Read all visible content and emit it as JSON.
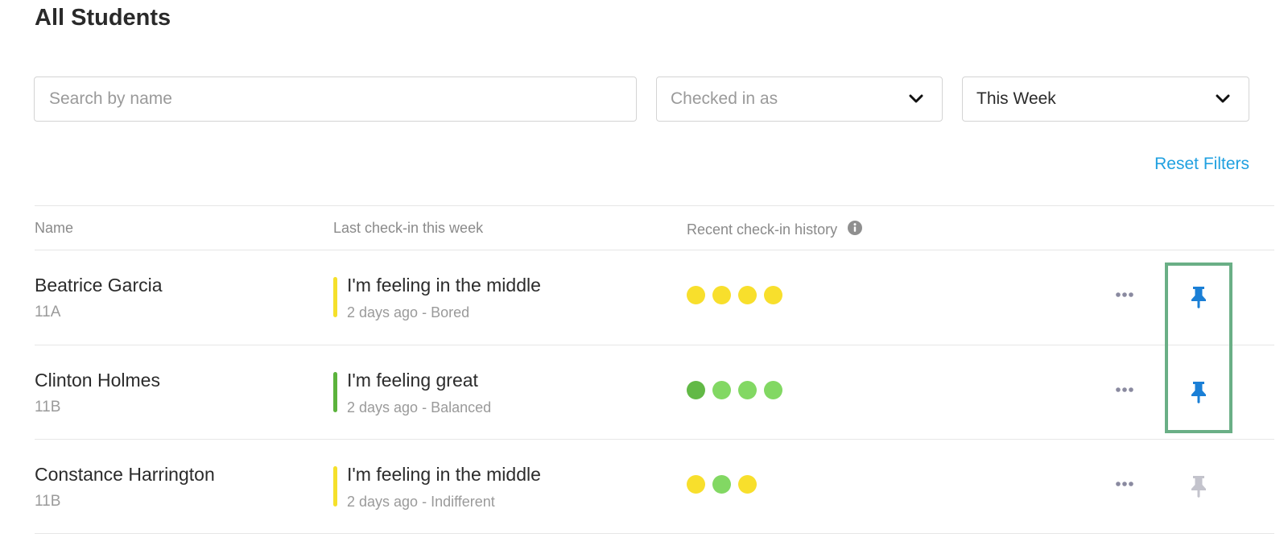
{
  "page": {
    "title": "All Students"
  },
  "filters": {
    "search_placeholder": "Search by name",
    "checked_in_placeholder": "Checked in as",
    "period_value": "This Week",
    "reset_label": "Reset Filters"
  },
  "table": {
    "headers": {
      "name": "Name",
      "last_checkin": "Last check-in this week",
      "history": "Recent check-in history"
    },
    "rows": [
      {
        "name": "Beatrice Garcia",
        "class": "11A",
        "feeling": "I'm feeling in the middle",
        "detail": "2 days ago - Bored",
        "bar_color": "#f5e02b",
        "history": [
          "#f8df2c",
          "#f8df2c",
          "#f8df2c",
          "#f8df2c"
        ],
        "pinned": true
      },
      {
        "name": "Clinton Holmes",
        "class": "11B",
        "feeling": "I'm feeling great",
        "detail": "2 days ago - Balanced",
        "bar_color": "#5bb33c",
        "history": [
          "#62b946",
          "#82d863",
          "#82d863",
          "#82d863"
        ],
        "pinned": true
      },
      {
        "name": "Constance Harrington",
        "class": "11B",
        "feeling": "I'm feeling in the middle",
        "detail": "2 days ago - Indifferent",
        "bar_color": "#f5e02b",
        "history": [
          "#f8df2c",
          "#82d863",
          "#f8df2c"
        ],
        "pinned": false
      }
    ]
  },
  "colors": {
    "accent": "#1fa0e0",
    "pin_active": "#1a7fd6",
    "pin_inactive": "#c3c3cc",
    "highlight": "#6aaf86"
  },
  "icons": {
    "select_arrow": "chevron-down-icon",
    "info": "info-icon",
    "more": "more-dots-icon",
    "pin": "pin-icon"
  }
}
